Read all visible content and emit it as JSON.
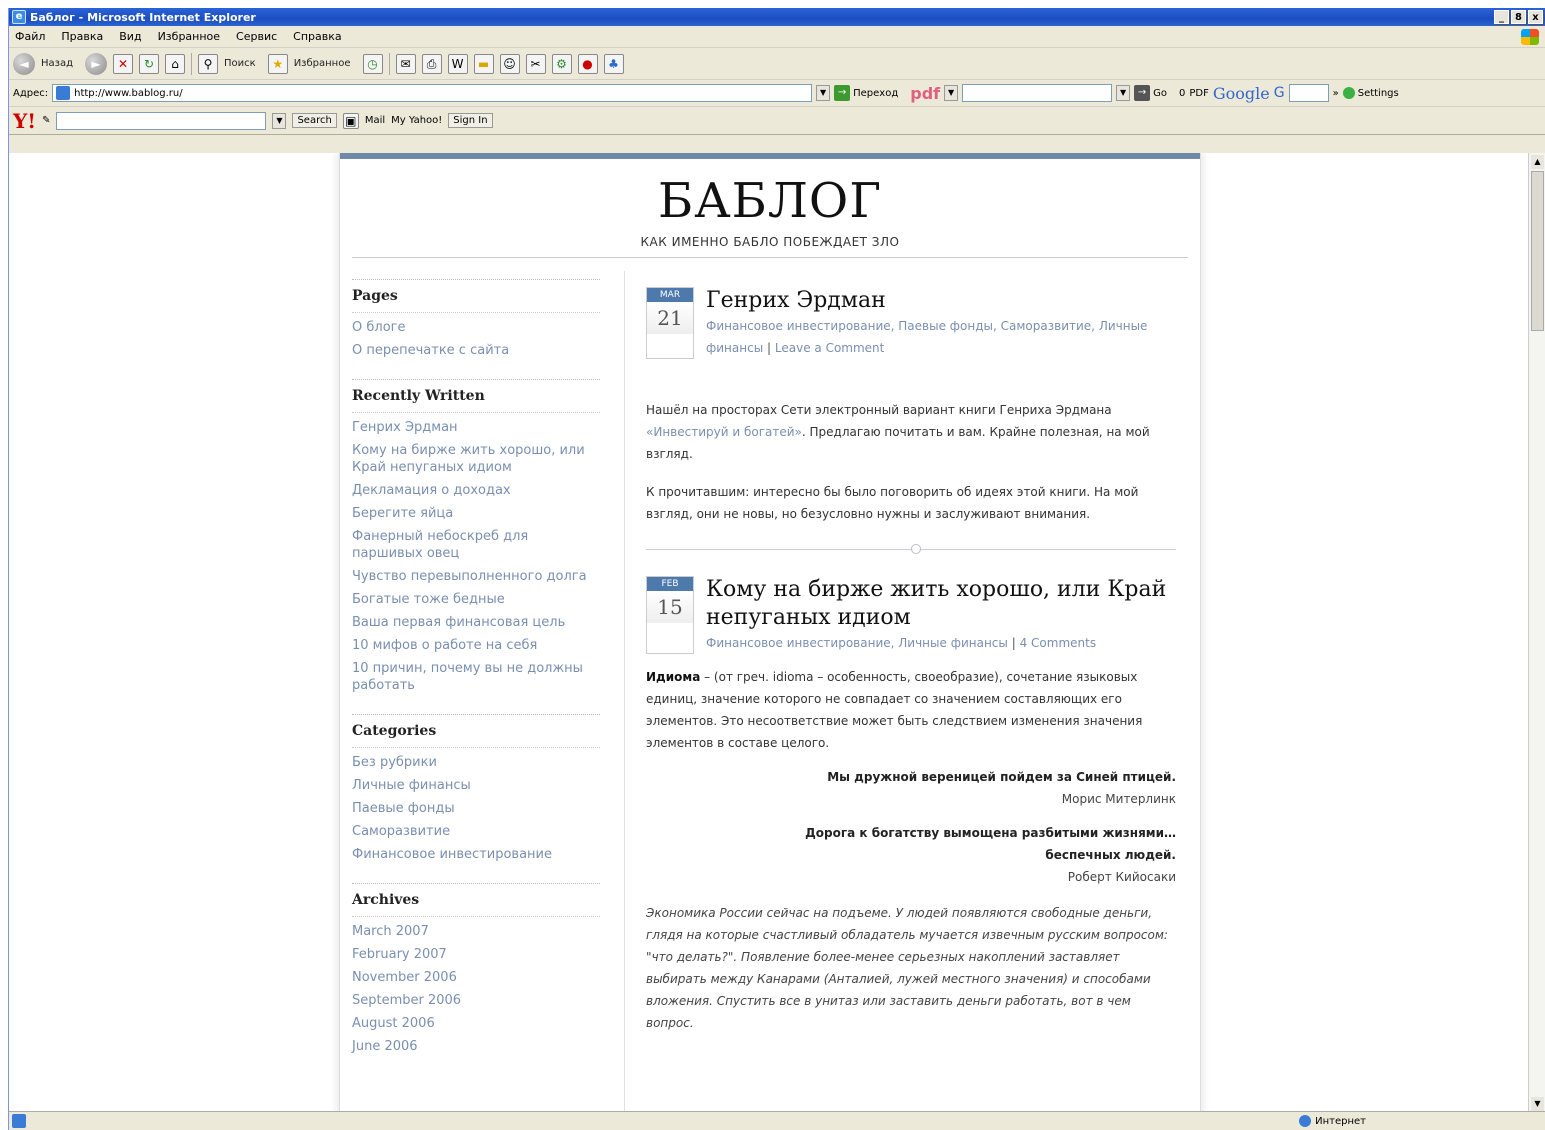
{
  "window": {
    "title": "Баблог - Microsoft Internet Explorer",
    "controls": [
      "_",
      "8",
      "x"
    ]
  },
  "menu": [
    "Файл",
    "Правка",
    "Вид",
    "Избранное",
    "Сервис",
    "Справка"
  ],
  "toolbar": {
    "back": "Назад",
    "search": "Поиск",
    "favorites": "Избранное"
  },
  "addressbar": {
    "label": "Адрес:",
    "url": "http://www.bablog.ru/",
    "go": "Переход",
    "pdf": "pdf",
    "go2": "Go",
    "counter": "0",
    "pdf2": "PDF",
    "google": "Google",
    "google_g": "G",
    "more": "»",
    "settings": "Settings"
  },
  "yahoo": {
    "logo": "Y!",
    "search": "Search",
    "mail": "Mail",
    "my_yahoo": "My Yahoo!",
    "sign_in": "Sign In"
  },
  "blog": {
    "title": "БАБЛОГ",
    "description": "КАК ИМЕННО БАБЛО ПОБЕЖДАЕТ ЗЛО"
  },
  "sidebar": {
    "pages_title": "Pages",
    "pages": [
      "О блоге",
      "О перепечатке с сайта"
    ],
    "recent_title": "Recently Written",
    "recent": [
      "Генрих Эрдман",
      "Кому на бирже жить хорошо, или Край непуганых идиом",
      "Декламация о доходах",
      "Берегите яйца",
      "Фанерный небоскреб для паршивых овец",
      "Чувство перевыполненного долга",
      "Богатые тоже бедные",
      "Ваша первая финансовая цель",
      "10 мифов о работе на себя",
      "10 причин, почему вы не должны работать"
    ],
    "categories_title": "Categories",
    "categories": [
      "Без рубрики",
      "Личные финансы",
      "Паевые фонды",
      "Саморазвитие",
      "Финансовое инвестирование"
    ],
    "archives_title": "Archives",
    "archives": [
      "March 2007",
      "February 2007",
      "November 2006",
      "September 2006",
      "August 2006",
      "June 2006"
    ]
  },
  "post1": {
    "month": "MAR",
    "day": "21",
    "title": "Генрих Эрдман",
    "cats": [
      "Финансовое инвестирование",
      "Паевые фонды",
      "Саморазвитие",
      "Личные финансы"
    ],
    "comment": "Leave a Comment",
    "p1_a": "Нашёл на просторах Сети электронный вариант книги Генриха Эрдмана ",
    "p1_link": "«Инвестируй и богатей»",
    "p1_b": ". Предлагаю почитать и вам. Крайне полезная, на мой взгляд.",
    "p2": "К прочитавшим: интересно бы было поговорить об идеях этой книги. На мой взгляд, они не новы, но безусловно нужны и заслуживают внимания."
  },
  "post2": {
    "month": "FEB",
    "day": "15",
    "title": "Кому на бирже жить хорошо, или Край непуганых идиом",
    "cats": [
      "Финансовое инвестирование",
      "Личные финансы"
    ],
    "comment": "4 Comments",
    "term": "Идиома",
    "definition": " – (от греч. idioma – особенность, своеобразие), сочетание языковых единиц, значение которого не совпадает со значением составляющих его элементов. Это несоответствие может быть следствием изменения значения элементов в составе целого.",
    "quote1": "Мы дружной вереницей пойдем за Синей птицей.",
    "author1": "Морис Митерлинк",
    "quote2": "Дорога к богатству вымощена разбитыми жизнями… беспечных людей.",
    "author2": "Роберт Кийосаки",
    "italic": "Экономика России сейчас на подъеме. У людей появляются свободные деньги, глядя на которые счастливый обладатель мучается извечным русским вопросом: \"что делать?\". Появление более-менее серьезных накоплений заставляет выбирать между Канарами (Анталией, лужей местного значения) и способами вложения. Спустить все в унитаз или заставить деньги работать, вот в чем вопрос."
  },
  "status": {
    "zone": "Интернет"
  }
}
